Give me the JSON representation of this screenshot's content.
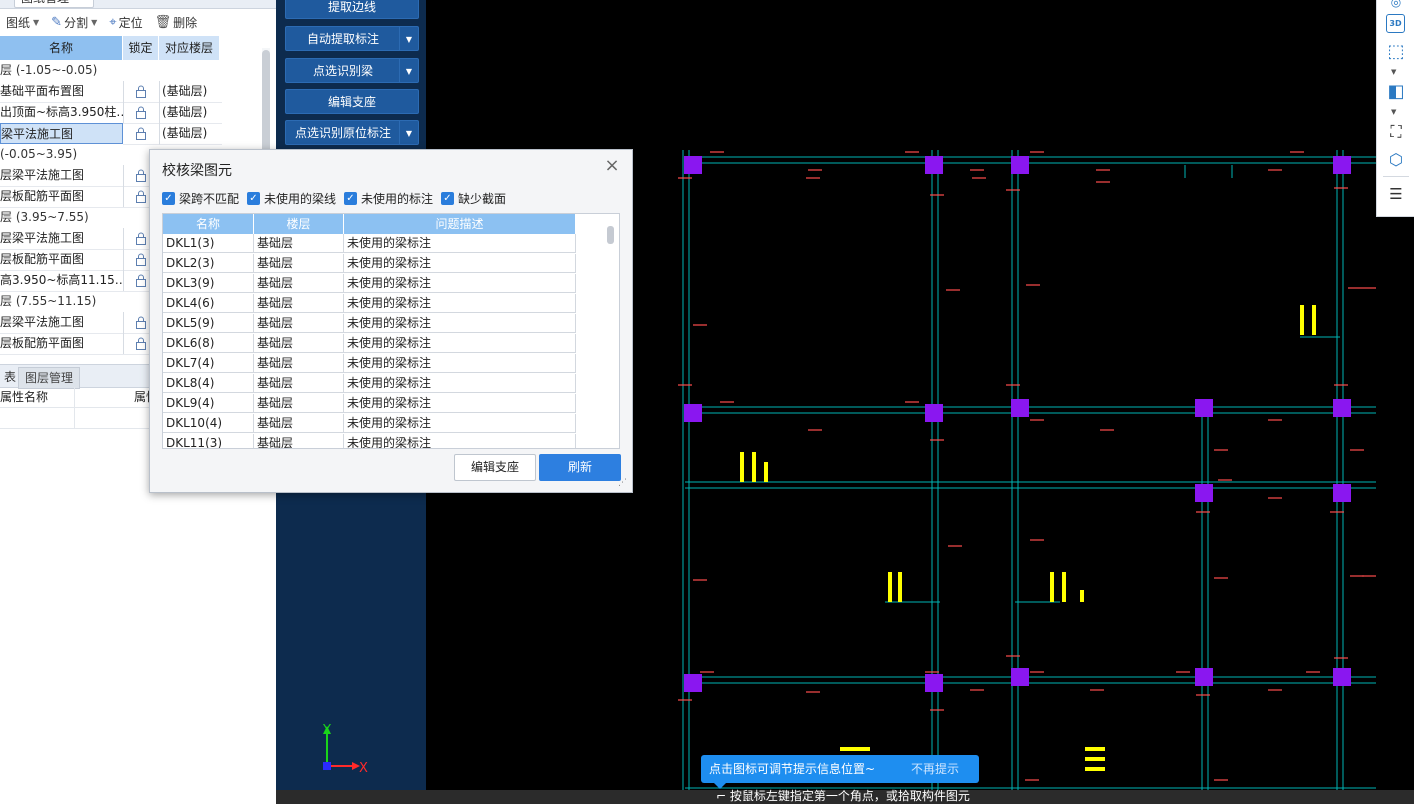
{
  "left_panel": {
    "top_tab": "图纸管理",
    "toolbar": {
      "drawings": "图纸",
      "split": "分割",
      "locate": "定位",
      "delete": "删除"
    },
    "columns": [
      "名称",
      "锁定",
      "对应楼层"
    ],
    "rows": [
      {
        "type": "group",
        "name": "层 (-1.05~-0.05)"
      },
      {
        "type": "item",
        "name": "基础平面布置图",
        "floor": "(基础层)"
      },
      {
        "type": "item",
        "name": "出顶面~标高3.950柱…",
        "floor": "(基础层)"
      },
      {
        "type": "item",
        "name": "梁平法施工图",
        "floor": "(基础层)",
        "selected": true
      },
      {
        "type": "group",
        "name": "(-0.05~3.95)"
      },
      {
        "type": "item",
        "name": "层梁平法施工图",
        "floor": ""
      },
      {
        "type": "item",
        "name": "层板配筋平面图",
        "floor": ""
      },
      {
        "type": "group",
        "name": "层 (3.95~7.55)"
      },
      {
        "type": "item",
        "name": "层梁平法施工图",
        "floor": ""
      },
      {
        "type": "item",
        "name": "层板配筋平面图",
        "floor": ""
      },
      {
        "type": "item",
        "name": "高3.950~标高11.15…",
        "floor": ""
      },
      {
        "type": "group",
        "name": "层 (7.55~11.15)"
      },
      {
        "type": "item",
        "name": "层梁平法施工图",
        "floor": ""
      },
      {
        "type": "item",
        "name": "层板配筋平面图",
        "floor": ""
      }
    ],
    "bottom_tabs": [
      "表",
      "图层管理"
    ],
    "prop_columns": [
      "属性名称",
      "属性"
    ]
  },
  "blue_toolbar": [
    {
      "label": "提取边线",
      "dropdown": false
    },
    {
      "label": "自动提取标注",
      "dropdown": true
    },
    {
      "label": "点选识别梁",
      "dropdown": true
    },
    {
      "label": "编辑支座",
      "dropdown": false
    },
    {
      "label": "点选识别原位标注",
      "dropdown": true
    }
  ],
  "dialog": {
    "title": "校核梁图元",
    "checkboxes": [
      {
        "label": "梁跨不匹配",
        "checked": true
      },
      {
        "label": "未使用的梁线",
        "checked": true
      },
      {
        "label": "未使用的标注",
        "checked": true
      },
      {
        "label": "缺少截面",
        "checked": true
      }
    ],
    "columns": [
      "名称",
      "楼层",
      "问题描述"
    ],
    "rows": [
      [
        "DKL1(3)",
        "基础层",
        "未使用的梁标注"
      ],
      [
        "DKL2(3)",
        "基础层",
        "未使用的梁标注"
      ],
      [
        "DKL3(9)",
        "基础层",
        "未使用的梁标注"
      ],
      [
        "DKL4(6)",
        "基础层",
        "未使用的梁标注"
      ],
      [
        "DKL5(9)",
        "基础层",
        "未使用的梁标注"
      ],
      [
        "DKL6(8)",
        "基础层",
        "未使用的梁标注"
      ],
      [
        "DKL7(4)",
        "基础层",
        "未使用的梁标注"
      ],
      [
        "DKL8(4)",
        "基础层",
        "未使用的梁标注"
      ],
      [
        "DKL9(4)",
        "基础层",
        "未使用的梁标注"
      ],
      [
        "DKL10(4)",
        "基础层",
        "未使用的梁标注"
      ],
      [
        "DKL11(3)",
        "基础层",
        "未使用的梁标注"
      ]
    ],
    "buttons": {
      "edit_support": "编辑支座",
      "refresh": "刷新"
    }
  },
  "canvas": {
    "axis_y": "Y",
    "axis_x": "X"
  },
  "tooltip": {
    "text": "点击图标可调节提示信息位置~",
    "dismiss": "不再提示"
  },
  "status": {
    "prompt": "按鼠标左键指定第一个角点，或拾取构件图元"
  },
  "right_toolbar": [
    "3D"
  ],
  "colors": {
    "grid_line": "#00b4b4",
    "column": "#8a17f0",
    "beam_label": "#ff4d4d",
    "annotation": "#ffff00",
    "panel_blue": "#0d2b4e",
    "button_blue": "#1f5a9e",
    "accent": "#2d7fe0"
  }
}
